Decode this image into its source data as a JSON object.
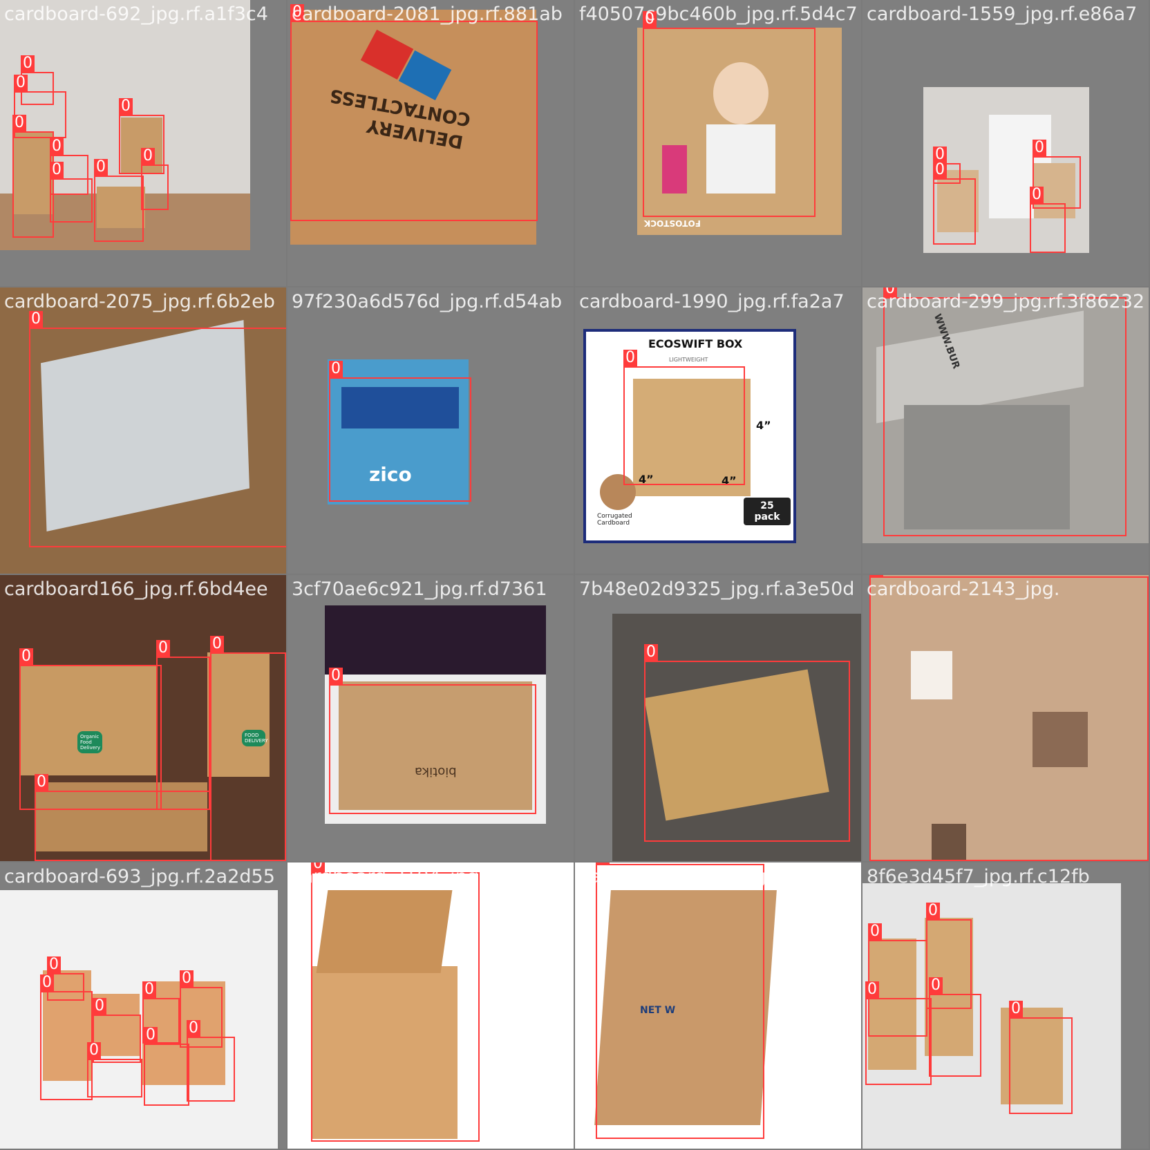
{
  "class_label": "0",
  "colors": {
    "box": "#ff3b3b",
    "cardboard": "#c79a62",
    "pad": "#7f7f7f"
  },
  "tiles": [
    {
      "filename": "cardboard-692_jpg.rf.a1f3c4",
      "bg": "#d9d6d2",
      "texts": []
    },
    {
      "filename": "cardboard-2081_jpg.rf.881ab",
      "bg": "#c68f5b",
      "texts": [
        "CONTACTLESS",
        "DELIVERY"
      ]
    },
    {
      "filename": "f40507c9bc460b_jpg.rf.5d4c7",
      "bg": "#cfa776",
      "texts": [
        "FOTOSTOCK"
      ]
    },
    {
      "filename": "cardboard-1559_jpg.rf.e86a7",
      "bg": "#d7d4d0",
      "texts": []
    },
    {
      "filename": "cardboard-2075_jpg.rf.6b2eb",
      "bg": "#8f6a45",
      "texts": []
    },
    {
      "filename": "97f230a6d576d_jpg.rf.d54ab",
      "bg": "#4a9ccc",
      "texts": [
        "zico"
      ]
    },
    {
      "filename": "cardboard-1990_jpg.rf.fa2a7",
      "bg": "#ffffff",
      "texts": [
        "ECOSWIFT BOX",
        "LIGHTWEIGHT",
        "4”",
        "4”",
        "4”",
        "25 pack",
        "Corrugated Cardboard"
      ]
    },
    {
      "filename": "cardboard-299_jpg.rf.3f86232",
      "bg": "#a7a49f",
      "texts": [
        "WWW.BUR"
      ]
    },
    {
      "filename": "cardboard166_jpg.rf.6bd4ee",
      "bg": "#5a3a2a",
      "texts": [
        "Organic Food Delivery",
        "FOOD DELIVERY"
      ]
    },
    {
      "filename": "3cf70ae6c921_jpg.rf.d7361",
      "bg": "#c69d6f",
      "texts": [
        "biotika"
      ]
    },
    {
      "filename": "7b48e02d9325_jpg.rf.a3e50d",
      "bg": "#56524e",
      "texts": []
    },
    {
      "filename": "cardboard-2143_jpg.",
      "bg": "#caa88a",
      "texts": []
    },
    {
      "filename": "cardboard-693_jpg.rf.2a2d55",
      "bg": "#f2f2f2",
      "texts": []
    },
    {
      "filename": "cardboard-2104_jpg.rf.ba11c",
      "bg": "#ffffff",
      "texts": []
    },
    {
      "filename": "cardboard-2054_jpg.rf.8f303",
      "bg": "#ffffff",
      "texts": [
        "NET W"
      ]
    },
    {
      "filename": "8f6e3d45f7_jpg.rf.c12fb",
      "bg": "#e6e6e6",
      "texts": []
    }
  ]
}
